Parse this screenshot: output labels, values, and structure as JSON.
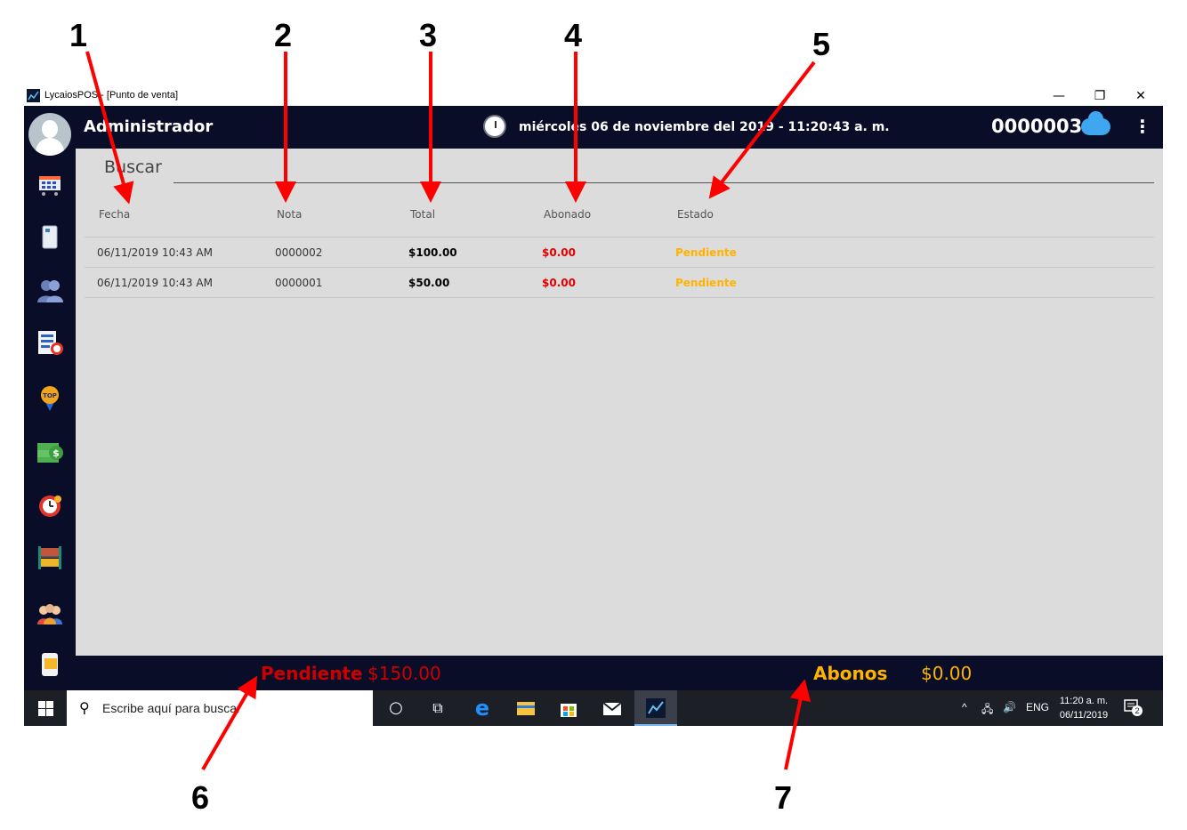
{
  "annotations": {
    "n1": "1",
    "n2": "2",
    "n3": "3",
    "n4": "4",
    "n5": "5",
    "n6": "6",
    "n7": "7"
  },
  "window": {
    "title": "LycaiosPOS - [Punto de venta]",
    "minimize": "—",
    "restore": "❐",
    "close": "✕"
  },
  "header": {
    "user": "Administrador",
    "datetime": "miércoles 06 de noviembre del 2019 - 11:20:43 a. m.",
    "ticket": "0000003",
    "menu": "⋮"
  },
  "sidebar": {
    "icons": [
      "cart-register-icon",
      "notebook-icon",
      "users-icon",
      "report-clock-icon",
      "top-badge-icon",
      "money-icon",
      "alarm-clock-icon",
      "shelves-icon",
      "team-icon",
      "mobile-card-icon"
    ]
  },
  "search": {
    "label": "Buscar"
  },
  "table": {
    "headers": {
      "fecha": "Fecha",
      "nota": "Nota",
      "total": "Total",
      "abonado": "Abonado",
      "estado": "Estado"
    },
    "rows": [
      {
        "fecha": "06/11/2019 10:43 AM",
        "nota": "0000002",
        "total": "$100.00",
        "abonado": "$0.00",
        "estado": "Pendiente"
      },
      {
        "fecha": "06/11/2019 10:43 AM",
        "nota": "0000001",
        "total": "$50.00",
        "abonado": "$0.00",
        "estado": "Pendiente"
      }
    ]
  },
  "footer": {
    "pending_label": "Pendiente",
    "pending_value": "$150.00",
    "payments_label": "Abonos",
    "payments_value": "$0.00"
  },
  "taskbar": {
    "search_placeholder": "Escribe aquí para buscar",
    "search_glyph": "⚲",
    "cortana_glyph": "○",
    "taskview_glyph": "⧉",
    "tray_chevron": "^",
    "tray_network": "🖧",
    "tray_volume": "🔊",
    "language": "ENG",
    "time": "11:20 a. m.",
    "date": "06/11/2019",
    "notifications": "2"
  },
  "colors": {
    "header_bg": "#0a0d28",
    "content_bg": "#dcdcdc",
    "pending": "#ffb300",
    "debt": "#e00000",
    "annotation_arrow": "#ff0000"
  }
}
